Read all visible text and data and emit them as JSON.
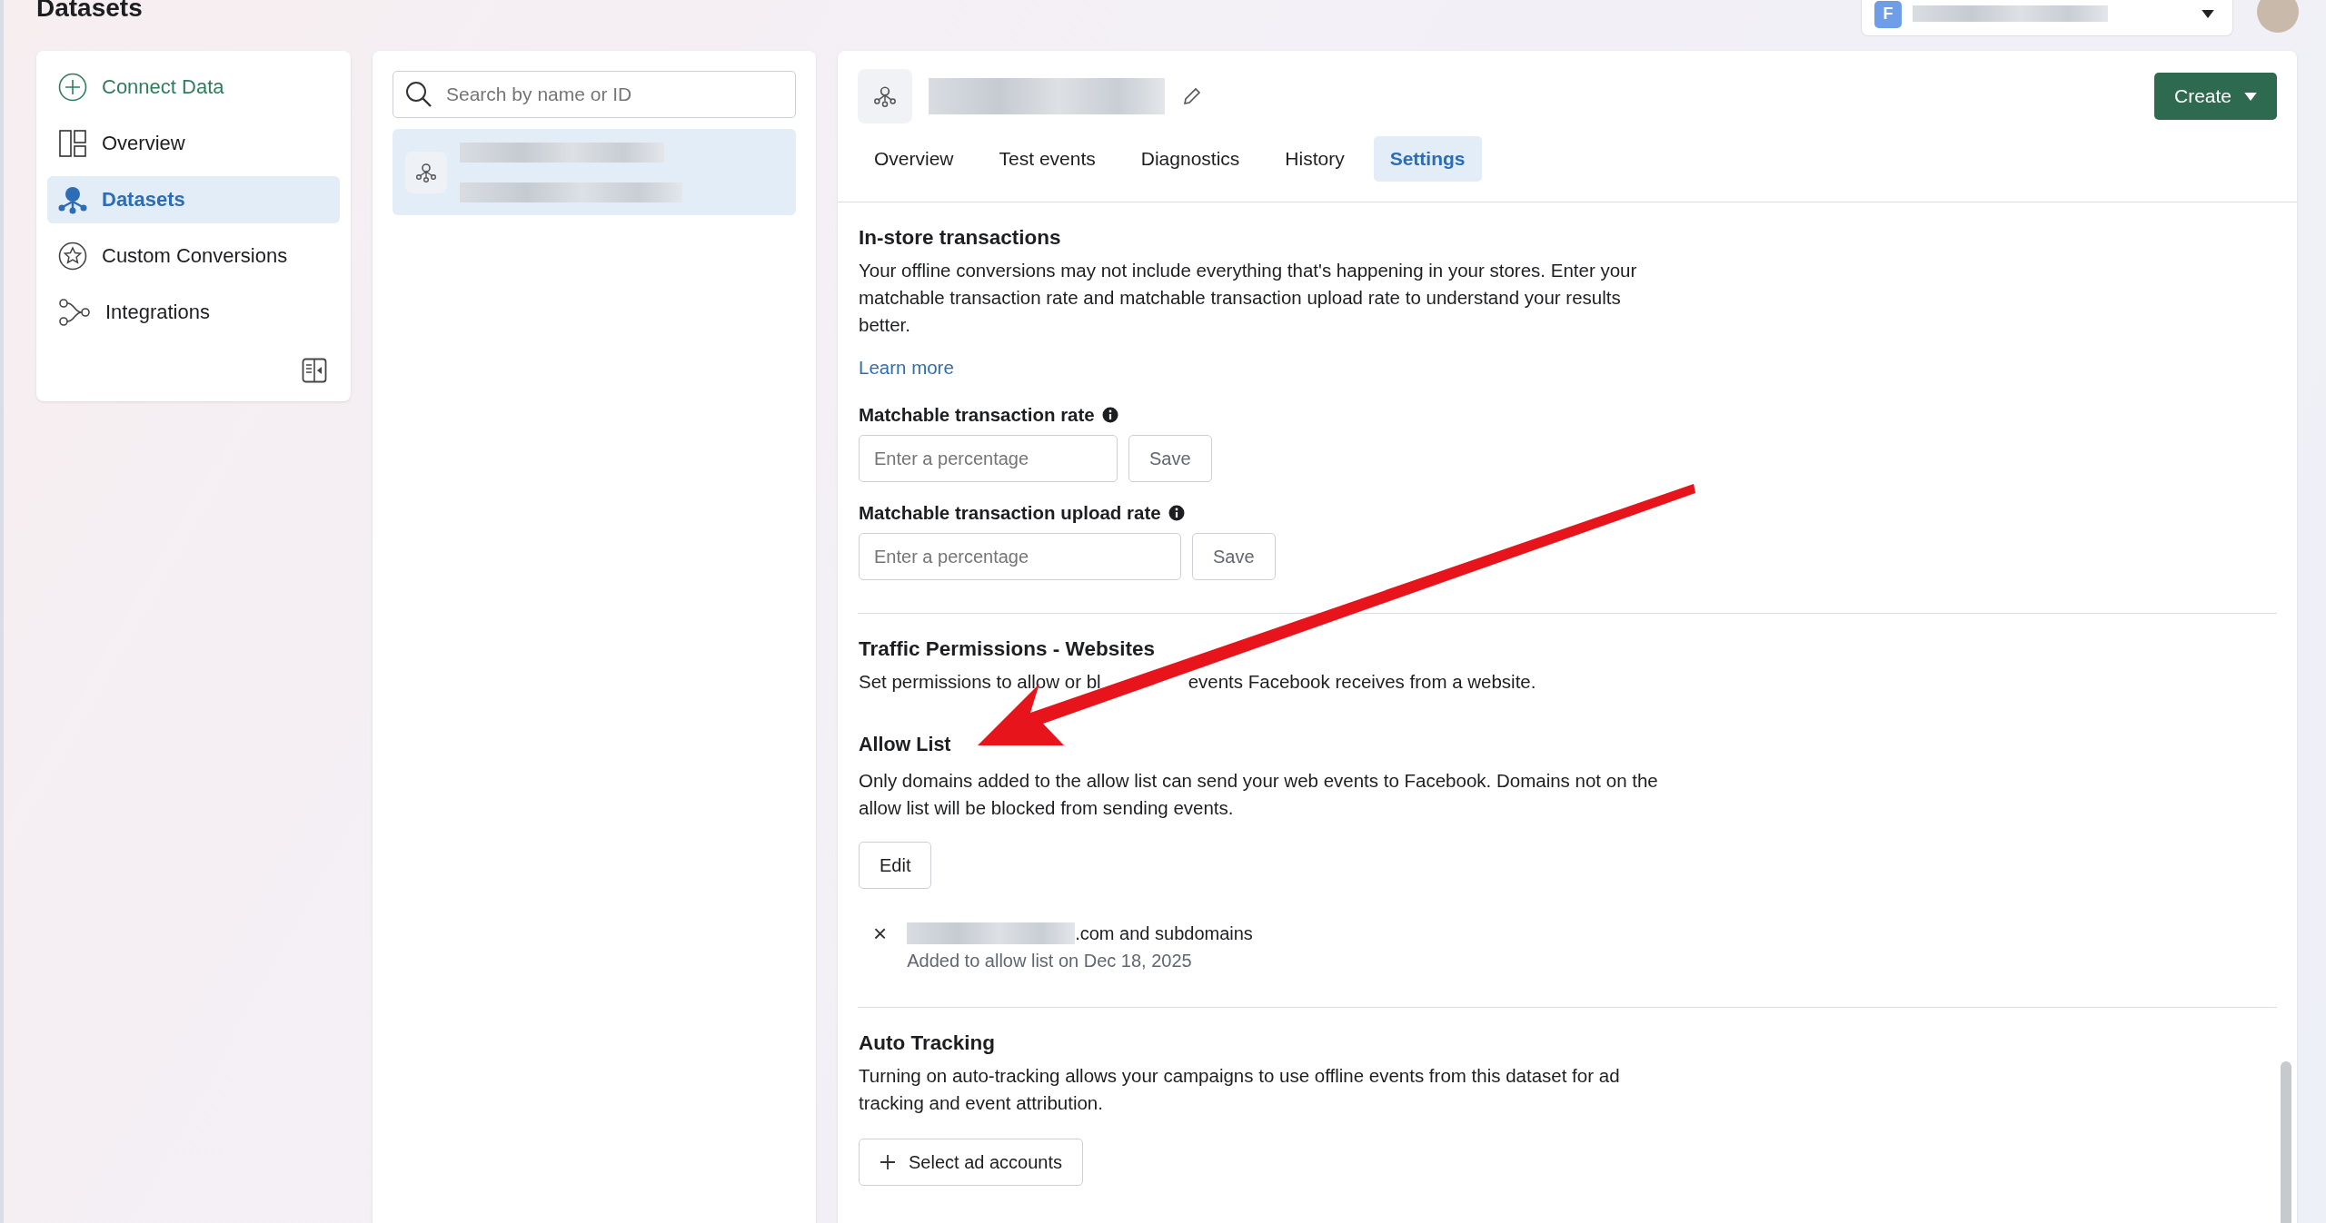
{
  "page_title": "Datasets",
  "account_switcher": {
    "initial": "F"
  },
  "sidebar": {
    "items": [
      {
        "label": "Connect Data",
        "kind": "action",
        "selected": false
      },
      {
        "label": "Overview",
        "kind": "nav",
        "selected": false
      },
      {
        "label": "Datasets",
        "kind": "nav",
        "selected": true
      },
      {
        "label": "Custom Conversions",
        "kind": "nav",
        "selected": false
      },
      {
        "label": "Integrations",
        "kind": "nav",
        "selected": false
      }
    ]
  },
  "search": {
    "placeholder": "Search by name or ID"
  },
  "dataset_list": [
    {
      "selected": true
    }
  ],
  "header": {
    "create_button": "Create"
  },
  "tabs": [
    {
      "label": "Overview",
      "selected": false
    },
    {
      "label": "Test events",
      "selected": false
    },
    {
      "label": "Diagnostics",
      "selected": false
    },
    {
      "label": "History",
      "selected": false
    },
    {
      "label": "Settings",
      "selected": true
    }
  ],
  "in_store": {
    "title": "In-store transactions",
    "description": "Your offline conversions may not include everything that's happening in your stores. Enter your matchable transaction rate and matchable transaction upload rate to understand your results better.",
    "link": "Learn more",
    "fields": [
      {
        "label": "Matchable transaction rate",
        "placeholder": "Enter a percentage",
        "button": "Save"
      },
      {
        "label": "Matchable transaction upload rate",
        "placeholder": "Enter a percentage",
        "button": "Save"
      }
    ]
  },
  "traffic_permissions": {
    "title": "Traffic Permissions - Websites",
    "description_parts": [
      "Set permissions to allow or bl",
      "events Facebook receives from a website."
    ]
  },
  "allow_list": {
    "title": "Allow List",
    "description": "Only domains added to the allow list can send your web events to Facebook. Domains not on the allow list will be blocked from sending events.",
    "edit_button": "Edit",
    "domains": [
      {
        "remove": "×",
        "text": ".com and subdomains",
        "added": "Added to allow list on Dec 18, 2025"
      }
    ]
  },
  "auto_tracking": {
    "title": "Auto Tracking",
    "description": "Turning on auto-tracking allows your campaigns to use offline events from this dataset for ad tracking and event attribution.",
    "button": "Select ad accounts"
  }
}
